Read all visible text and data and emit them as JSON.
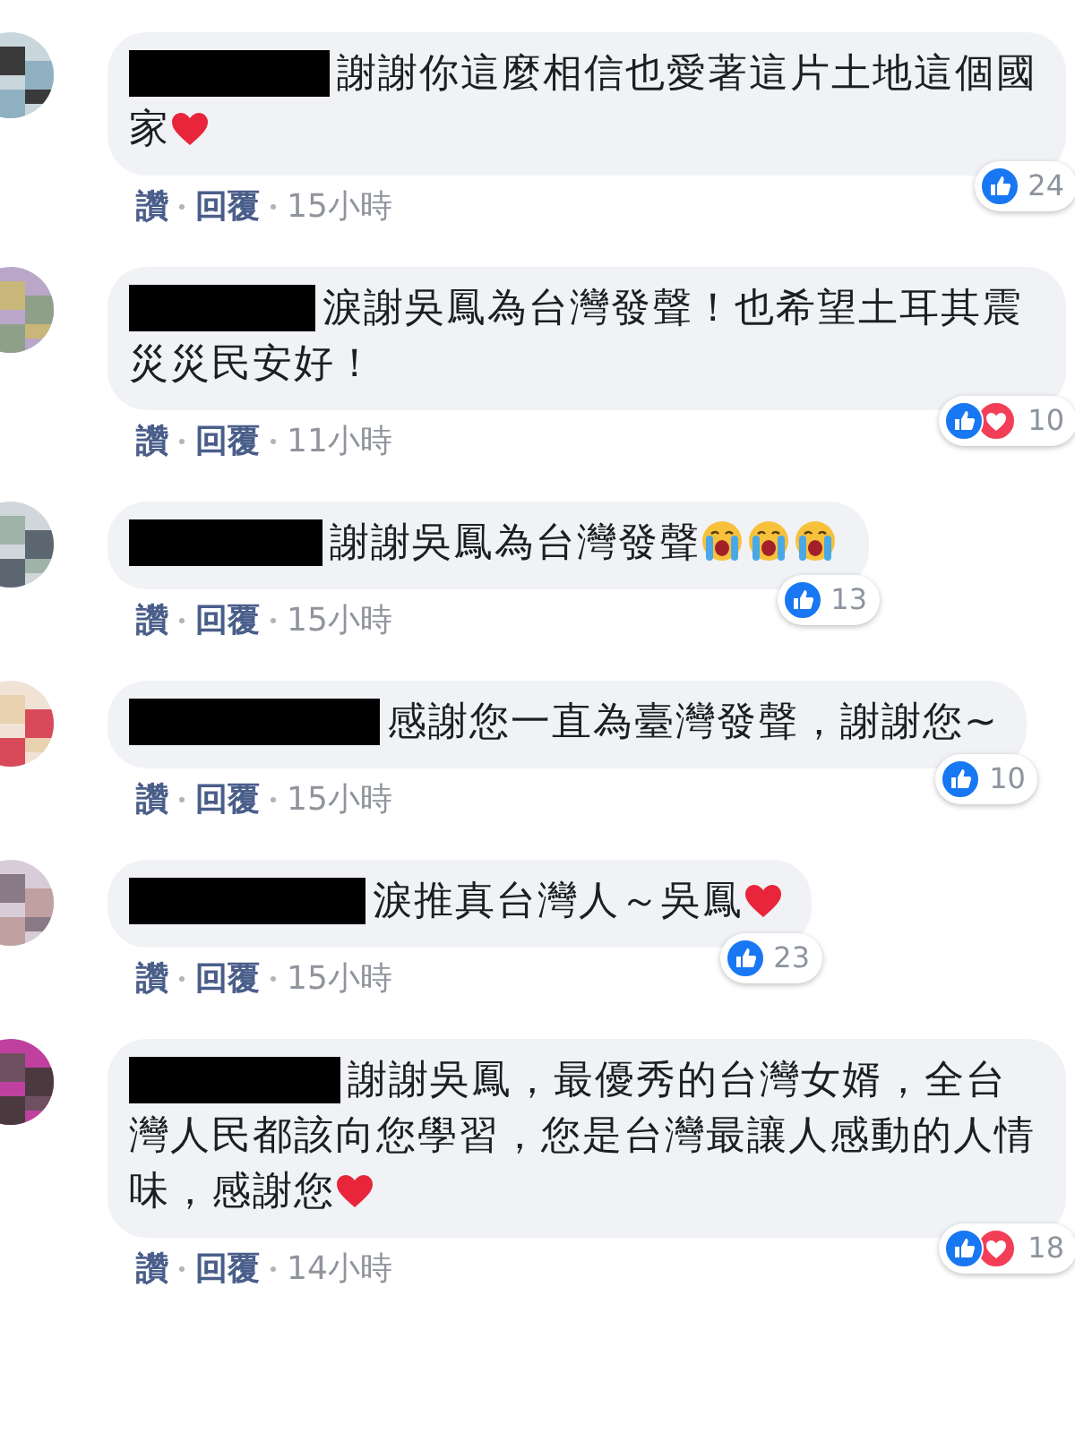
{
  "comments": [
    {
      "text": "謝謝你這麼相信也愛著這片土地這個國家",
      "emojis": [
        {
          "kind": "heart"
        }
      ],
      "reactions": [
        {
          "kind": "like"
        }
      ],
      "reaction_count": "24",
      "actions": [
        "讚",
        "回覆"
      ],
      "time": "15小時"
    },
    {
      "text": "淚謝吳鳳為台灣發聲！也希望土耳其震災災民安好！",
      "reactions": [
        {
          "kind": "like"
        },
        {
          "kind": "love"
        }
      ],
      "reaction_count": "10",
      "actions": [
        "讚",
        "回覆"
      ],
      "time": "11小時"
    },
    {
      "text": "謝謝吳鳳為台灣發聲",
      "emojis": [
        {
          "kind": "crying"
        },
        {
          "kind": "crying"
        },
        {
          "kind": "crying"
        }
      ],
      "reactions": [
        {
          "kind": "like"
        }
      ],
      "reaction_count": "13",
      "actions": [
        "讚",
        "回覆"
      ],
      "time": "15小時"
    },
    {
      "text": "感謝您一直為臺灣發聲，謝謝您~",
      "reactions": [
        {
          "kind": "like"
        }
      ],
      "reaction_count": "10",
      "actions": [
        "讚",
        "回覆"
      ],
      "time": "15小時"
    },
    {
      "text": "淚推真台灣人～吳鳳",
      "emojis": [
        {
          "kind": "heart"
        }
      ],
      "reactions": [
        {
          "kind": "like"
        }
      ],
      "reaction_count": "23",
      "actions": [
        "讚",
        "回覆"
      ],
      "time": "15小時"
    },
    {
      "text": "謝謝吳鳳，最優秀的台灣女婿，全台灣人民都該向您學習，您是台灣最讓人感動的人情味，感謝您",
      "emojis": [
        {
          "kind": "heart"
        }
      ],
      "reactions": [
        {
          "kind": "like"
        },
        {
          "kind": "love"
        }
      ],
      "reaction_count": "18",
      "actions": [
        "讚",
        "回覆"
      ],
      "time": "14小時"
    }
  ]
}
